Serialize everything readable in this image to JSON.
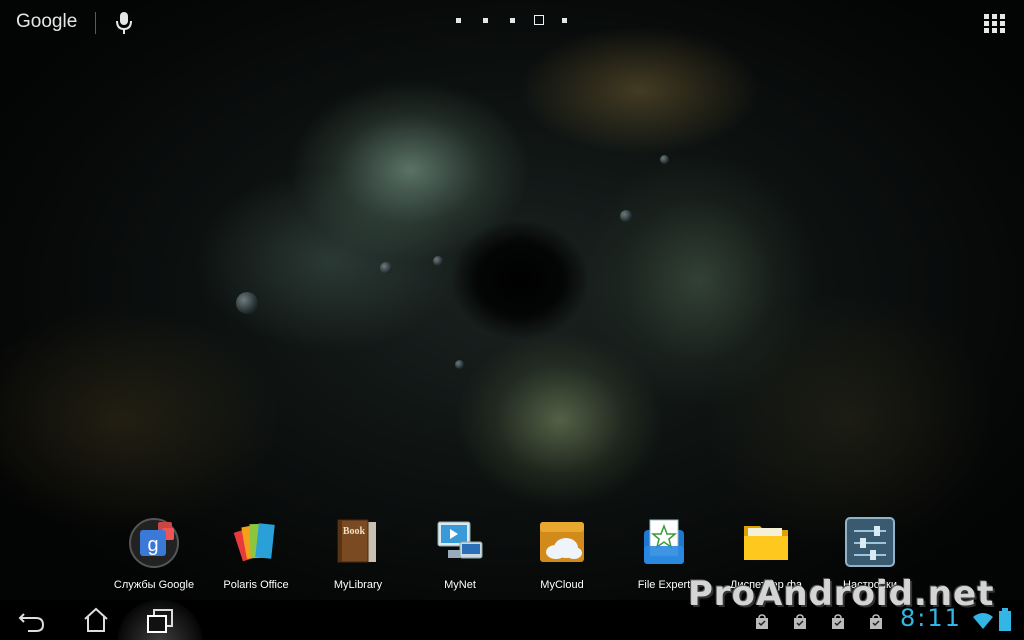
{
  "topbar": {
    "search_label": "Google",
    "page_count": 5,
    "current_page": 4
  },
  "dock": {
    "apps": [
      {
        "label": "Службы Google",
        "icon": "google-services-icon"
      },
      {
        "label": "Polaris Office",
        "icon": "polaris-office-icon"
      },
      {
        "label": "MyLibrary",
        "icon": "mylibrary-book-icon"
      },
      {
        "label": "MyNet",
        "icon": "mynet-icon"
      },
      {
        "label": "MyCloud",
        "icon": "mycloud-icon"
      },
      {
        "label": "File Expert",
        "icon": "file-expert-icon"
      },
      {
        "label": "Диспетчер фа",
        "icon": "file-manager-folder-icon"
      },
      {
        "label": "Настройки",
        "icon": "settings-sliders-icon"
      }
    ]
  },
  "navbar": {
    "buttons": [
      "back-icon",
      "home-icon",
      "recent-apps-icon"
    ]
  },
  "status": {
    "time": "8:11",
    "notifications": 4
  },
  "watermark": "ProAndroid.net",
  "colors": {
    "accent": "#33b5e5",
    "navbar_bg": "#000000"
  }
}
